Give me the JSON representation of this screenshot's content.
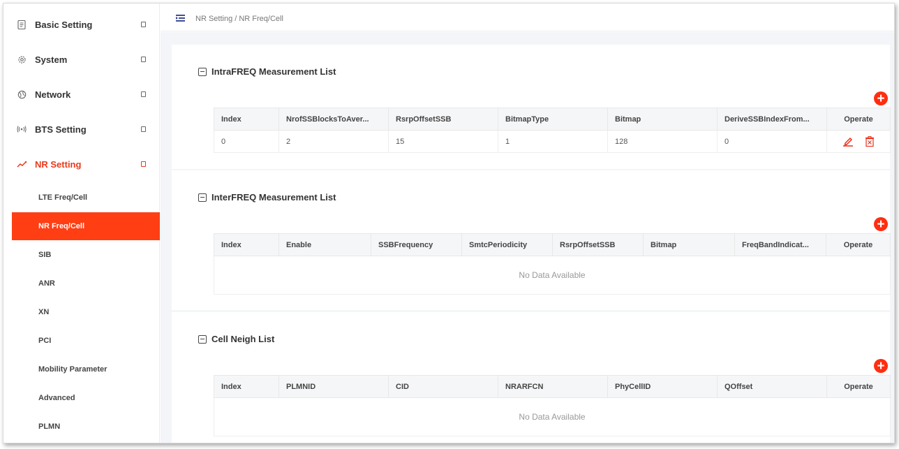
{
  "sidebar": {
    "menu": [
      {
        "label": "Basic Setting",
        "icon": "document-icon"
      },
      {
        "label": "System",
        "icon": "gear-icon"
      },
      {
        "label": "Network",
        "icon": "globe-icon"
      },
      {
        "label": "BTS Setting",
        "icon": "antenna-icon"
      },
      {
        "label": "NR Setting",
        "icon": "signal-icon"
      }
    ],
    "submenu": [
      {
        "label": "LTE Freq/Cell"
      },
      {
        "label": "NR Freq/Cell"
      },
      {
        "label": "SIB"
      },
      {
        "label": "ANR"
      },
      {
        "label": "XN"
      },
      {
        "label": "PCI"
      },
      {
        "label": "Mobility Parameter"
      },
      {
        "label": "Advanced"
      },
      {
        "label": "PLMN"
      }
    ]
  },
  "header": {
    "breadcrumb": "NR Setting / NR Freq/Cell"
  },
  "colors": {
    "accent": "#ff3e14",
    "active_text": "#e83a1c"
  },
  "sections": {
    "intra": {
      "title": "IntraFREQ Measurement List",
      "columns": [
        "Index",
        "NrofSSBlocksToAver...",
        "RsrpOffsetSSB",
        "BitmapType",
        "Bitmap",
        "DeriveSSBIndexFrom...",
        "Operate"
      ],
      "rows": [
        [
          "0",
          "2",
          "15",
          "1",
          "128",
          "0"
        ]
      ]
    },
    "inter": {
      "title": "InterFREQ Measurement List",
      "columns": [
        "Index",
        "Enable",
        "SSBFrequency",
        "SmtcPeriodicity",
        "RsrpOffsetSSB",
        "Bitmap",
        "FreqBandIndicat...",
        "Operate"
      ],
      "empty_text": "No Data Available"
    },
    "neigh": {
      "title": "Cell Neigh List",
      "columns": [
        "Index",
        "PLMNID",
        "CID",
        "NRARFCN",
        "PhyCellID",
        "QOffset",
        "Operate"
      ],
      "empty_text": "No Data Available"
    }
  }
}
